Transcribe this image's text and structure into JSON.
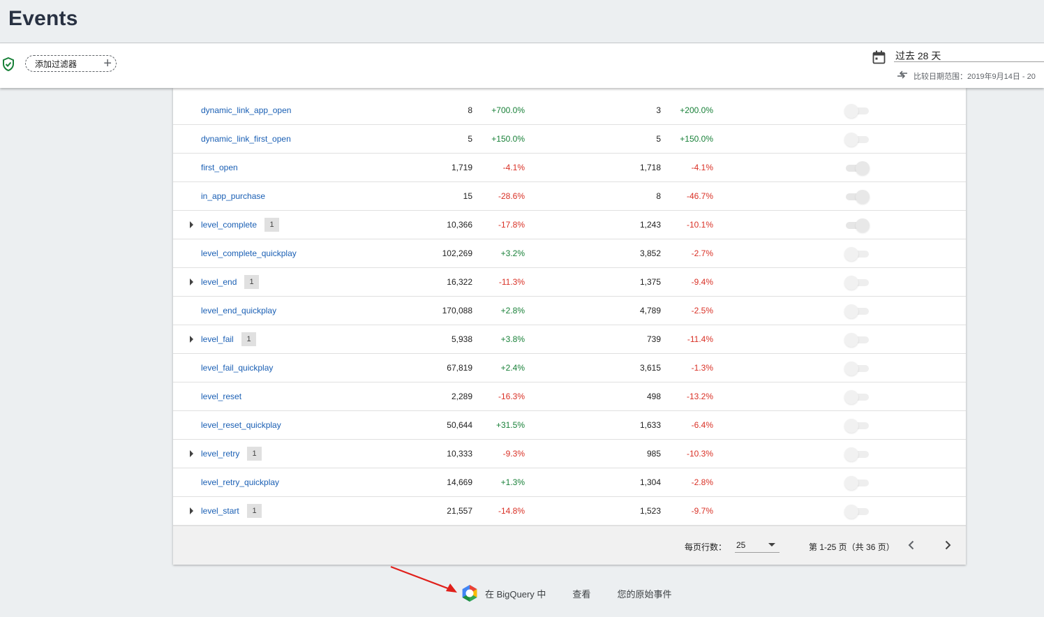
{
  "page": {
    "title": "Events"
  },
  "filter_bar": {
    "add_filter_label": "添加过滤器",
    "date_range": "过去 28 天",
    "compare_range": "比较日期范围：2019年9月14日 - 20"
  },
  "events": {
    "rows": [
      {
        "name": "dynamic_link_app_open",
        "badge": "",
        "count": "8",
        "count_change": "+700.0%",
        "users": "3",
        "users_change": "+200.0%",
        "conversion": "off"
      },
      {
        "name": "dynamic_link_first_open",
        "badge": "",
        "count": "5",
        "count_change": "+150.0%",
        "users": "5",
        "users_change": "+150.0%",
        "conversion": "off"
      },
      {
        "name": "first_open",
        "badge": "",
        "count": "1,719",
        "count_change": "-4.1%",
        "users": "1,718",
        "users_change": "-4.1%",
        "conversion": "on"
      },
      {
        "name": "in_app_purchase",
        "badge": "",
        "count": "15",
        "count_change": "-28.6%",
        "users": "8",
        "users_change": "-46.7%",
        "conversion": "on"
      },
      {
        "name": "level_complete",
        "badge": "1",
        "count": "10,366",
        "count_change": "-17.8%",
        "users": "1,243",
        "users_change": "-10.1%",
        "conversion": "on"
      },
      {
        "name": "level_complete_quickplay",
        "badge": "",
        "count": "102,269",
        "count_change": "+3.2%",
        "users": "3,852",
        "users_change": "-2.7%",
        "conversion": "off"
      },
      {
        "name": "level_end",
        "badge": "1",
        "count": "16,322",
        "count_change": "-11.3%",
        "users": "1,375",
        "users_change": "-9.4%",
        "conversion": "off"
      },
      {
        "name": "level_end_quickplay",
        "badge": "",
        "count": "170,088",
        "count_change": "+2.8%",
        "users": "4,789",
        "users_change": "-2.5%",
        "conversion": "off"
      },
      {
        "name": "level_fail",
        "badge": "1",
        "count": "5,938",
        "count_change": "+3.8%",
        "users": "739",
        "users_change": "-11.4%",
        "conversion": "off"
      },
      {
        "name": "level_fail_quickplay",
        "badge": "",
        "count": "67,819",
        "count_change": "+2.4%",
        "users": "3,615",
        "users_change": "-1.3%",
        "conversion": "off"
      },
      {
        "name": "level_reset",
        "badge": "",
        "count": "2,289",
        "count_change": "-16.3%",
        "users": "498",
        "users_change": "-13.2%",
        "conversion": "off"
      },
      {
        "name": "level_reset_quickplay",
        "badge": "",
        "count": "50,644",
        "count_change": "+31.5%",
        "users": "1,633",
        "users_change": "-6.4%",
        "conversion": "off"
      },
      {
        "name": "level_retry",
        "badge": "1",
        "count": "10,333",
        "count_change": "-9.3%",
        "users": "985",
        "users_change": "-10.3%",
        "conversion": "off"
      },
      {
        "name": "level_retry_quickplay",
        "badge": "",
        "count": "14,669",
        "count_change": "+1.3%",
        "users": "1,304",
        "users_change": "-2.8%",
        "conversion": "off"
      },
      {
        "name": "level_start",
        "badge": "1",
        "count": "21,557",
        "count_change": "-14.8%",
        "users": "1,523",
        "users_change": "-9.7%",
        "conversion": "off"
      }
    ]
  },
  "pagination": {
    "rows_per_page_label": "每页行数：",
    "rows_per_page_value": "25",
    "range_text": "第 1-25 页（共 36 页）"
  },
  "bigquery": {
    "text_part1": "在 BigQuery 中",
    "text_part2": "查看",
    "text_part3": "您的原始事件"
  },
  "colors": {
    "link": "#1a5fb4",
    "positive": "#188038",
    "negative": "#d93025",
    "annotation_arrow": "#e0201b"
  },
  "icons": [
    "shield-check-icon",
    "plus-icon",
    "calendar-icon",
    "compare-arrows-icon",
    "expand-arrow-icon",
    "chevron-down-icon",
    "chevron-left-icon",
    "chevron-right-icon",
    "bigquery-icon"
  ]
}
